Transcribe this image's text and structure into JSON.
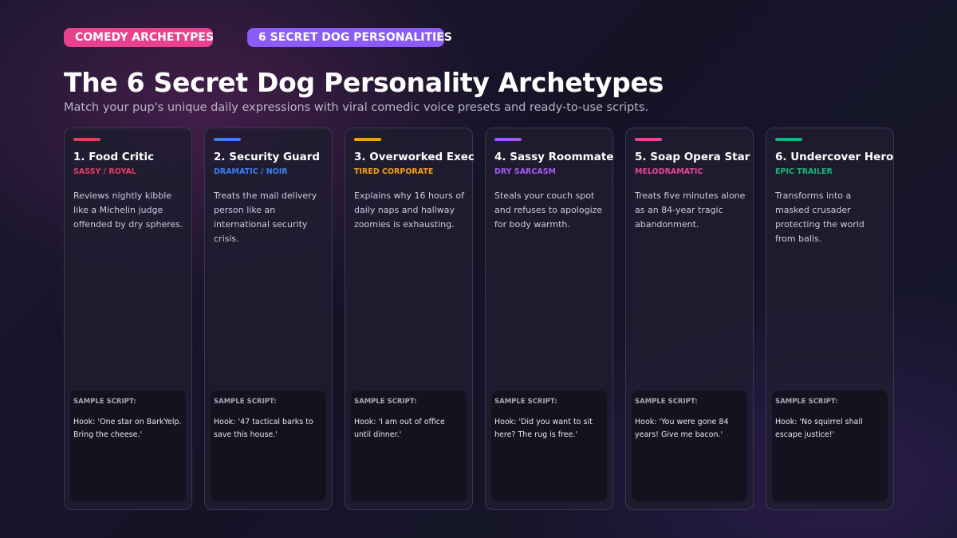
{
  "badges": [
    "COMEDY ARCHETYPES",
    "6 SECRET DOG PERSONALITIES"
  ],
  "title": "The 6 Secret Dog Personality Archetypes",
  "subtitle": "Match your pup's unique daily expressions with viral comedic voice presets and ready-to-use scripts.",
  "cards": [
    {
      "name": "1. Food Critic",
      "tag": "SASSY / ROYAL",
      "color": "#e0405e",
      "description": "Reviews nightly kibble like a Michelin judge offended by dry spheres.",
      "script_label": "SAMPLE SCRIPT:",
      "script": "Hook: 'One star on BarkYelp. Bring the cheese.'"
    },
    {
      "name": "2. Security Guard",
      "tag": "DRAMATIC / NOIR",
      "color": "#3b7ff0",
      "description": "Treats the mail delivery person like an international security crisis.",
      "script_label": "SAMPLE SCRIPT:",
      "script": "Hook: '47 tactical barks to save this house.'"
    },
    {
      "name": "3. Overworked Exec",
      "tag": "TIRED CORPORATE",
      "color": "#f59e1b",
      "description": "Explains why 16 hours of daily naps and hallway zoomies is exhausting.",
      "script_label": "SAMPLE SCRIPT:",
      "script": "Hook: 'I am out of office until dinner.'"
    },
    {
      "name": "4. Sassy Roommate",
      "tag": "DRY SARCASM",
      "color": "#a45bf0",
      "description": "Steals your couch spot and refuses to apologize for body warmth.",
      "script_label": "SAMPLE SCRIPT:",
      "script": "Hook: 'Did you want to sit here? The rug is free.'"
    },
    {
      "name": "5. Soap Opera Star",
      "tag": "MELODRAMATIC",
      "color": "#e5469a",
      "description": "Treats five minutes alone as an 84-year tragic abandonment.",
      "script_label": "SAMPLE SCRIPT:",
      "script": "Hook: 'You were gone 84 years! Give me bacon.'"
    },
    {
      "name": "6. Undercover Hero",
      "tag": "EPIC TRAILER",
      "color": "#17b57e",
      "description": "Transforms into a masked crusader protecting the world from balls.",
      "script_label": "SAMPLE SCRIPT:",
      "script": "Hook: 'No squirrel shall escape justice!'"
    }
  ]
}
